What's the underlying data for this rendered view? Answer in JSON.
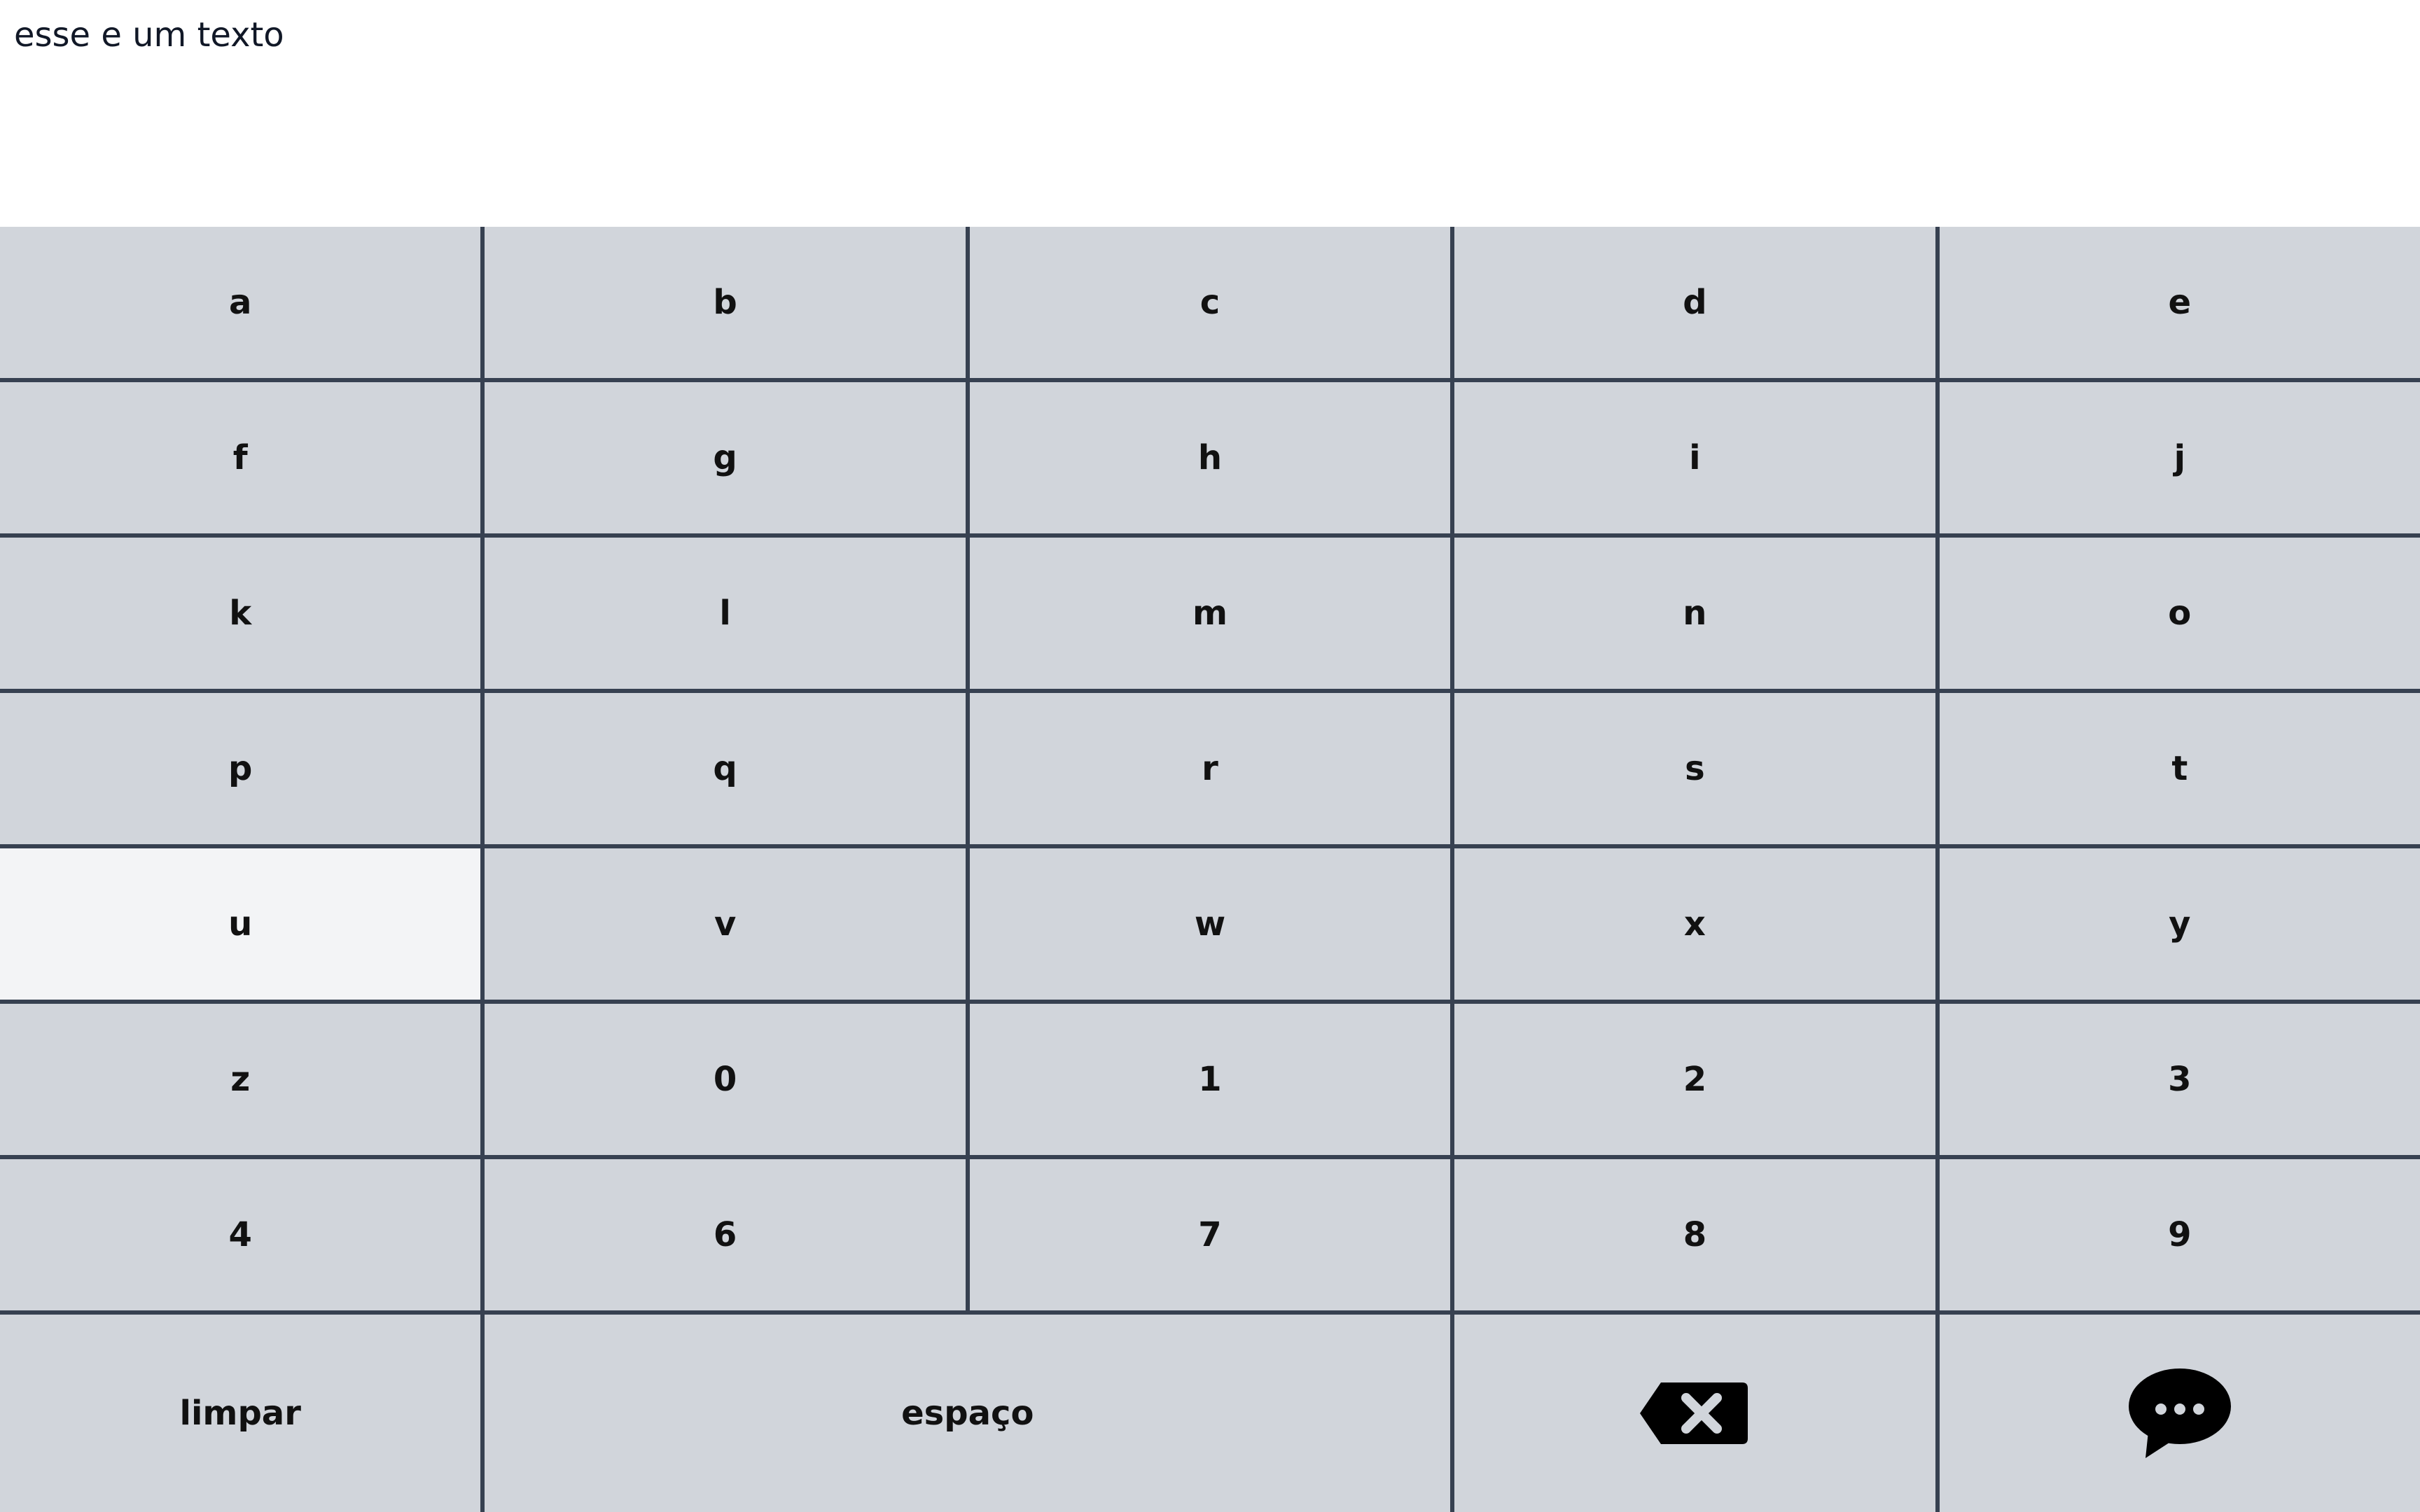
{
  "text_area": {
    "value": "esse e um texto"
  },
  "keyboard": {
    "rows": [
      [
        {
          "label": "a"
        },
        {
          "label": "b"
        },
        {
          "label": "c"
        },
        {
          "label": "d"
        },
        {
          "label": "e"
        }
      ],
      [
        {
          "label": "f"
        },
        {
          "label": "g"
        },
        {
          "label": "h"
        },
        {
          "label": "i"
        },
        {
          "label": "j"
        }
      ],
      [
        {
          "label": "k"
        },
        {
          "label": "l"
        },
        {
          "label": "m"
        },
        {
          "label": "n"
        },
        {
          "label": "o"
        }
      ],
      [
        {
          "label": "p"
        },
        {
          "label": "q"
        },
        {
          "label": "r"
        },
        {
          "label": "s"
        },
        {
          "label": "t"
        }
      ],
      [
        {
          "label": "u"
        },
        {
          "label": "v"
        },
        {
          "label": "w"
        },
        {
          "label": "x"
        },
        {
          "label": "y"
        }
      ],
      [
        {
          "label": "z"
        },
        {
          "label": "0"
        },
        {
          "label": "1"
        },
        {
          "label": "2"
        },
        {
          "label": "3"
        }
      ],
      [
        {
          "label": "4"
        },
        {
          "label": "6"
        },
        {
          "label": "7"
        },
        {
          "label": "8"
        },
        {
          "label": "9"
        }
      ]
    ],
    "highlighted_key": "u",
    "bottom": {
      "clear_label": "limpar",
      "space_label": "espaço",
      "backspace_icon": "backspace-icon",
      "speak_icon": "speech-bubble-icon"
    }
  },
  "colors": {
    "key_bg": "#d1d5db",
    "key_active_bg": "#f3f4f6",
    "grid_lines": "#374151",
    "text": "#111111"
  }
}
